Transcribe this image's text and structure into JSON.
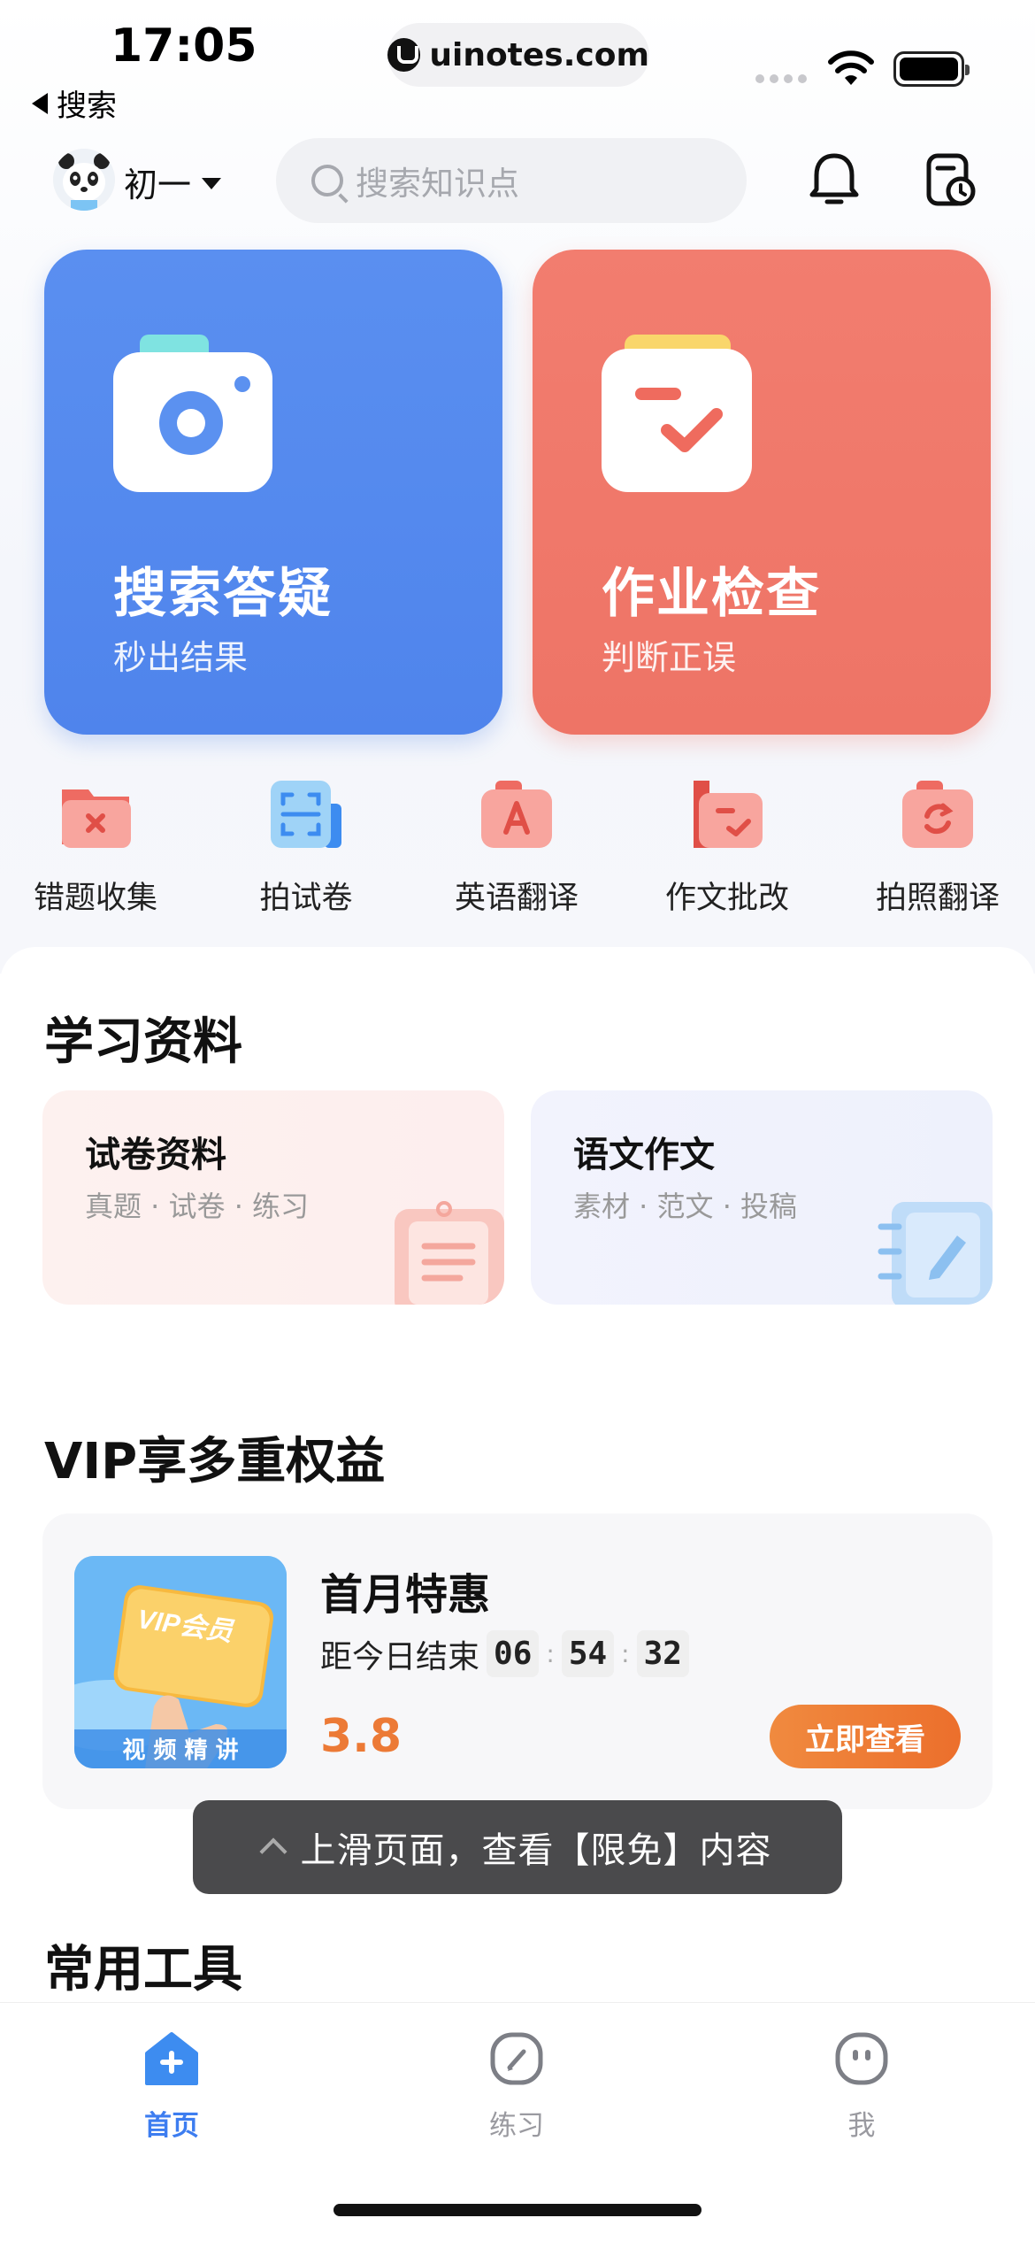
{
  "status_bar": {
    "time": "17:05",
    "back_label": "搜索",
    "url": "uinotes.com"
  },
  "header": {
    "grade": "初一",
    "search_placeholder": "搜索知识点",
    "icons": [
      "bell-icon",
      "history-icon"
    ]
  },
  "main_cards": [
    {
      "title": "搜索答疑",
      "subtitle": "秒出结果",
      "color": "#5289ee",
      "icon": "camera-icon"
    },
    {
      "title": "作业检查",
      "subtitle": "判断正误",
      "color": "#ef7a6c",
      "icon": "checklist-icon"
    }
  ],
  "tools": [
    {
      "label": "错题收集",
      "icon": "wrong-folder-icon"
    },
    {
      "label": "拍试卷",
      "icon": "scan-icon"
    },
    {
      "label": "英语翻译",
      "icon": "translate-icon"
    },
    {
      "label": "作文批改",
      "icon": "essay-icon"
    },
    {
      "label": "拍照翻译",
      "icon": "photo-translate-icon"
    }
  ],
  "study": {
    "title": "学习资料",
    "cards": [
      {
        "title": "试卷资料",
        "subtitle": "真题 · 试卷 · 练习"
      },
      {
        "title": "语文作文",
        "subtitle": "素材 · 范文 · 投稿"
      }
    ]
  },
  "vip": {
    "section_title": "VIP享多重权益",
    "image_badge": "VIP会员",
    "image_caption": "视 频 精 讲",
    "name": "首月特惠",
    "countdown_label": "距今日结束",
    "countdown": {
      "h": "06",
      "m": "54",
      "s": "32"
    },
    "price": "3.8",
    "button": "立即查看",
    "accent": "#ec7a36"
  },
  "toast": "上滑页面，查看【限免】内容",
  "tools_section_title": "常用工具",
  "tabbar": {
    "tabs": [
      {
        "label": "首页",
        "icon": "home-icon",
        "active": true
      },
      {
        "label": "练习",
        "icon": "practice-icon",
        "active": false
      },
      {
        "label": "我",
        "icon": "profile-icon",
        "active": false
      }
    ],
    "active_color": "#3d7df0"
  }
}
